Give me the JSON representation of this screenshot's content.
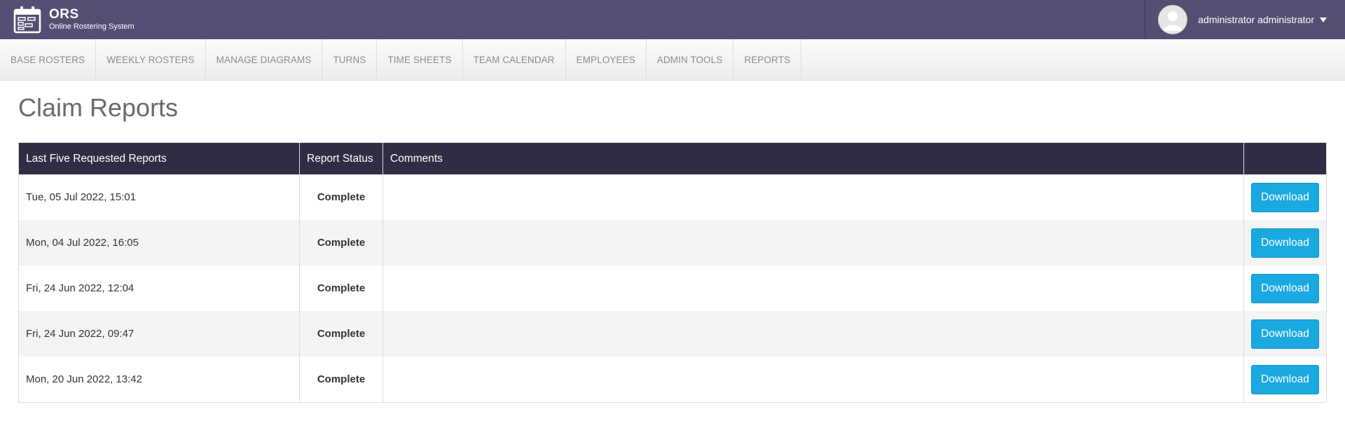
{
  "header": {
    "app_title": "ORS",
    "app_subtitle": "Online Rostering System",
    "user_name": "administrator administrator",
    "logo_icon": "calendar-icon",
    "user_icon": "avatar-icon",
    "colors": {
      "topbar": "#554e74",
      "table_header": "#312c43",
      "status_complete": "#2b8a1e",
      "button": "#1aa9e1"
    }
  },
  "nav": {
    "items": [
      {
        "label": "BASE ROSTERS"
      },
      {
        "label": "WEEKLY ROSTERS"
      },
      {
        "label": "MANAGE DIAGRAMS"
      },
      {
        "label": "TURNS"
      },
      {
        "label": "TIME SHEETS"
      },
      {
        "label": "TEAM CALENDAR"
      },
      {
        "label": "EMPLOYEES"
      },
      {
        "label": "ADMIN TOOLS"
      },
      {
        "label": "REPORTS"
      }
    ]
  },
  "page": {
    "title": "Claim Reports"
  },
  "table": {
    "headers": {
      "requested": "Last Five Requested Reports",
      "status": "Report Status",
      "comments": "Comments",
      "action": ""
    },
    "rows": [
      {
        "date": "Tue, 05 Jul 2022, 15:01",
        "status": "Complete",
        "comments": "",
        "action_label": "Download"
      },
      {
        "date": "Mon, 04 Jul 2022, 16:05",
        "status": "Complete",
        "comments": "",
        "action_label": "Download"
      },
      {
        "date": "Fri, 24 Jun 2022, 12:04",
        "status": "Complete",
        "comments": "",
        "action_label": "Download"
      },
      {
        "date": "Fri, 24 Jun 2022, 09:47",
        "status": "Complete",
        "comments": "",
        "action_label": "Download"
      },
      {
        "date": "Mon, 20 Jun 2022, 13:42",
        "status": "Complete",
        "comments": "",
        "action_label": "Download"
      }
    ]
  }
}
